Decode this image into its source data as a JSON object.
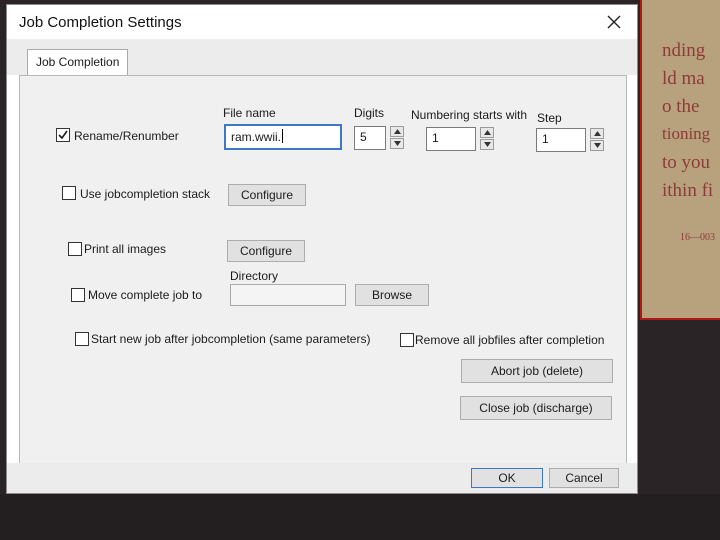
{
  "window": {
    "title": "Job Completion Settings",
    "close_icon": "✕"
  },
  "tabs": [
    {
      "label": "Job Completion"
    }
  ],
  "rename": {
    "checked": true,
    "label": "Rename/Renumber",
    "file_name_label": "File name",
    "file_name_value": "ram.wwii.",
    "digits_label": "Digits",
    "digits_value": "5",
    "start_label": "Numbering starts with",
    "start_value": "1",
    "step_label": "Step",
    "step_value": "1"
  },
  "stack": {
    "checked": false,
    "label": "Use jobcompletion stack",
    "button": "Configure"
  },
  "print": {
    "checked": false,
    "label": "Print all images",
    "button": "Configure"
  },
  "move": {
    "checked": false,
    "label": "Move complete job to",
    "directory_label": "Directory",
    "directory_value": "",
    "button": "Browse"
  },
  "new_job": {
    "checked": false,
    "label": "Start new job after jobcompletion (same parameters)"
  },
  "remove": {
    "checked": false,
    "label": "Remove all jobfiles after completion"
  },
  "abort_button": "Abort job (delete)",
  "close_job_button": "Close job (discharge)",
  "footer": {
    "ok": "OK",
    "cancel": "Cancel"
  },
  "background_text": [
    "nding",
    "ld ma",
    "o the",
    "tioning",
    "to you",
    "ithin fi",
    "16—003"
  ]
}
